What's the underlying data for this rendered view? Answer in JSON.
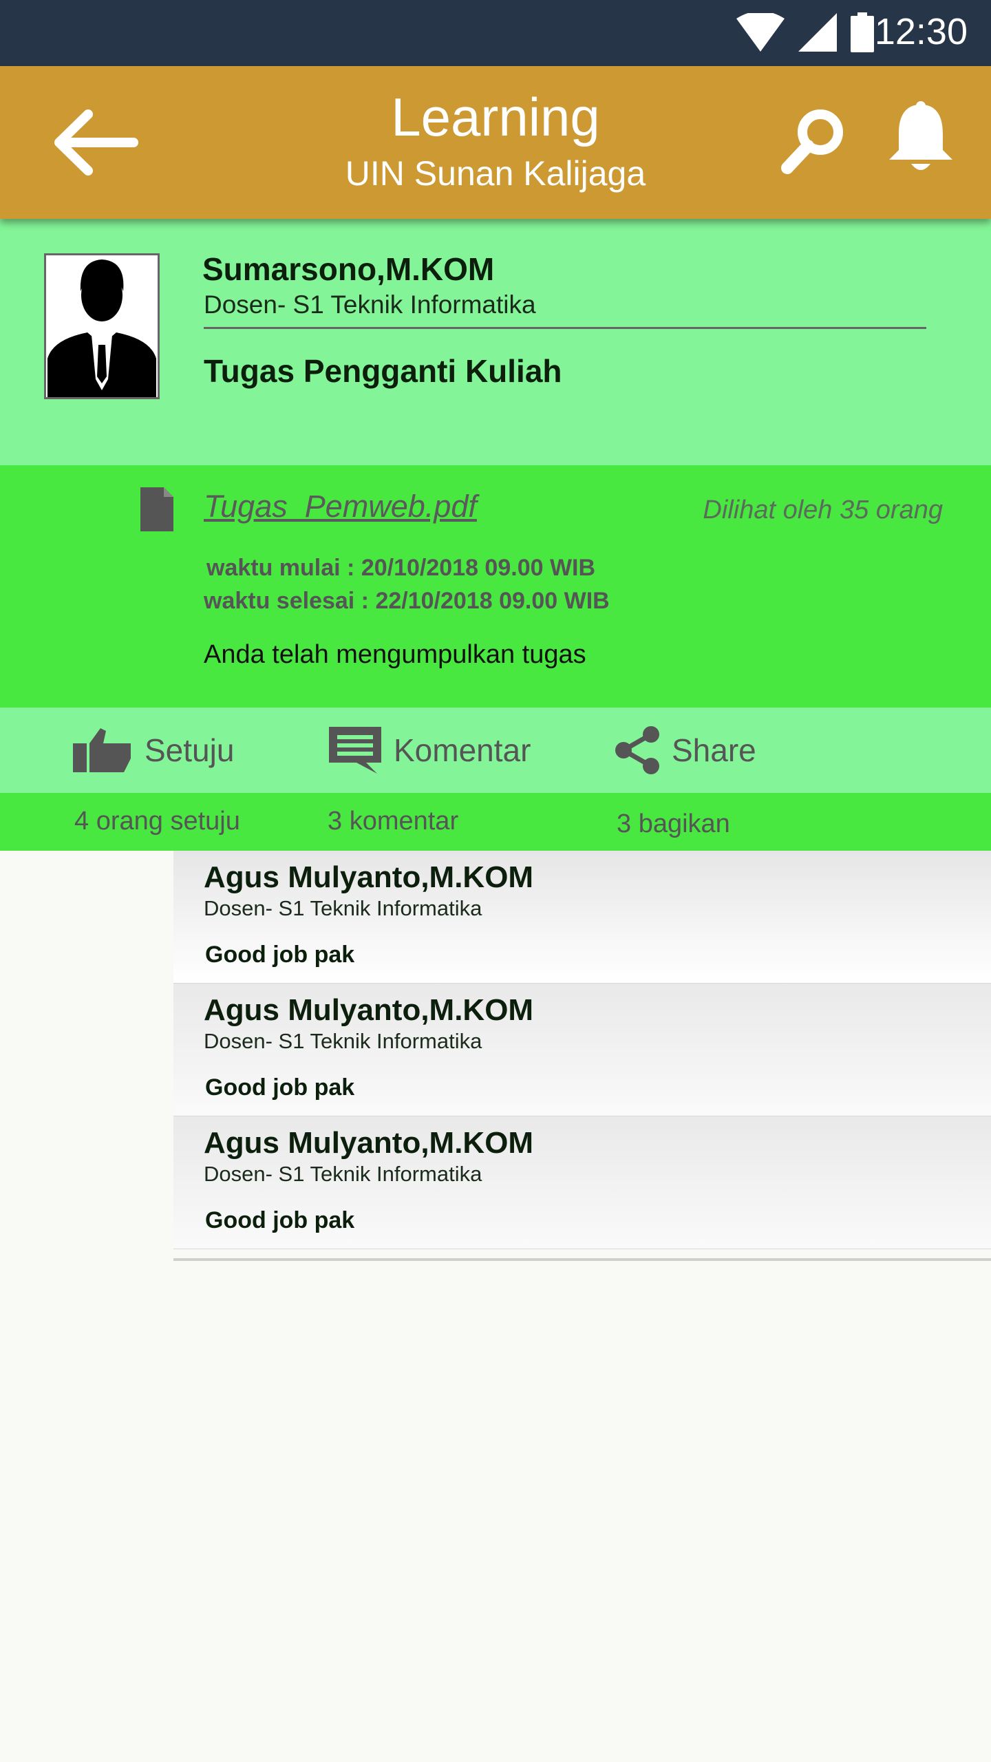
{
  "status_bar": {
    "time": "12:30",
    "icons": [
      "wifi-icon",
      "signal-icon",
      "battery-icon"
    ]
  },
  "app_bar": {
    "title": "Learning",
    "subtitle": "UIN Sunan Kalijaga",
    "icons": [
      "back-arrow-icon",
      "search-icon",
      "bell-icon"
    ]
  },
  "post": {
    "author_name": "Sumarsono,M.KOM",
    "author_role": "Dosen- S1 Teknik Informatika",
    "title": "Tugas Pengganti Kuliah"
  },
  "assignment": {
    "file_name": "Tugas_Pemweb.pdf",
    "views": "Dilihat oleh 35 orang",
    "start_time": "waktu mulai : 20/10/2018 09.00 WIB",
    "end_time": "waktu selesai : 22/10/2018 09.00 WIB",
    "status": "Anda telah mengumpulkan tugas"
  },
  "actions": {
    "like_label": "Setuju",
    "comment_label": "Komentar",
    "share_label": "Share"
  },
  "counts": {
    "likes": "4 orang setuju",
    "comments": "3 komentar",
    "shares": "3 bagikan"
  },
  "comments": [
    {
      "name": "Agus Mulyanto,M.KOM",
      "role": "Dosen- S1 Teknik Informatika",
      "text": "Good job pak"
    },
    {
      "name": "Agus Mulyanto,M.KOM",
      "role": "Dosen- S1 Teknik Informatika",
      "text": "Good job pak"
    },
    {
      "name": "Agus Mulyanto,M.KOM",
      "role": "Dosen- S1 Teknik Informatika",
      "text": "Good job pak"
    }
  ],
  "colors": {
    "status_bar": "#263547",
    "app_bar": "#cd9933",
    "light_green": "#83f497",
    "bright_green": "#48e840"
  }
}
